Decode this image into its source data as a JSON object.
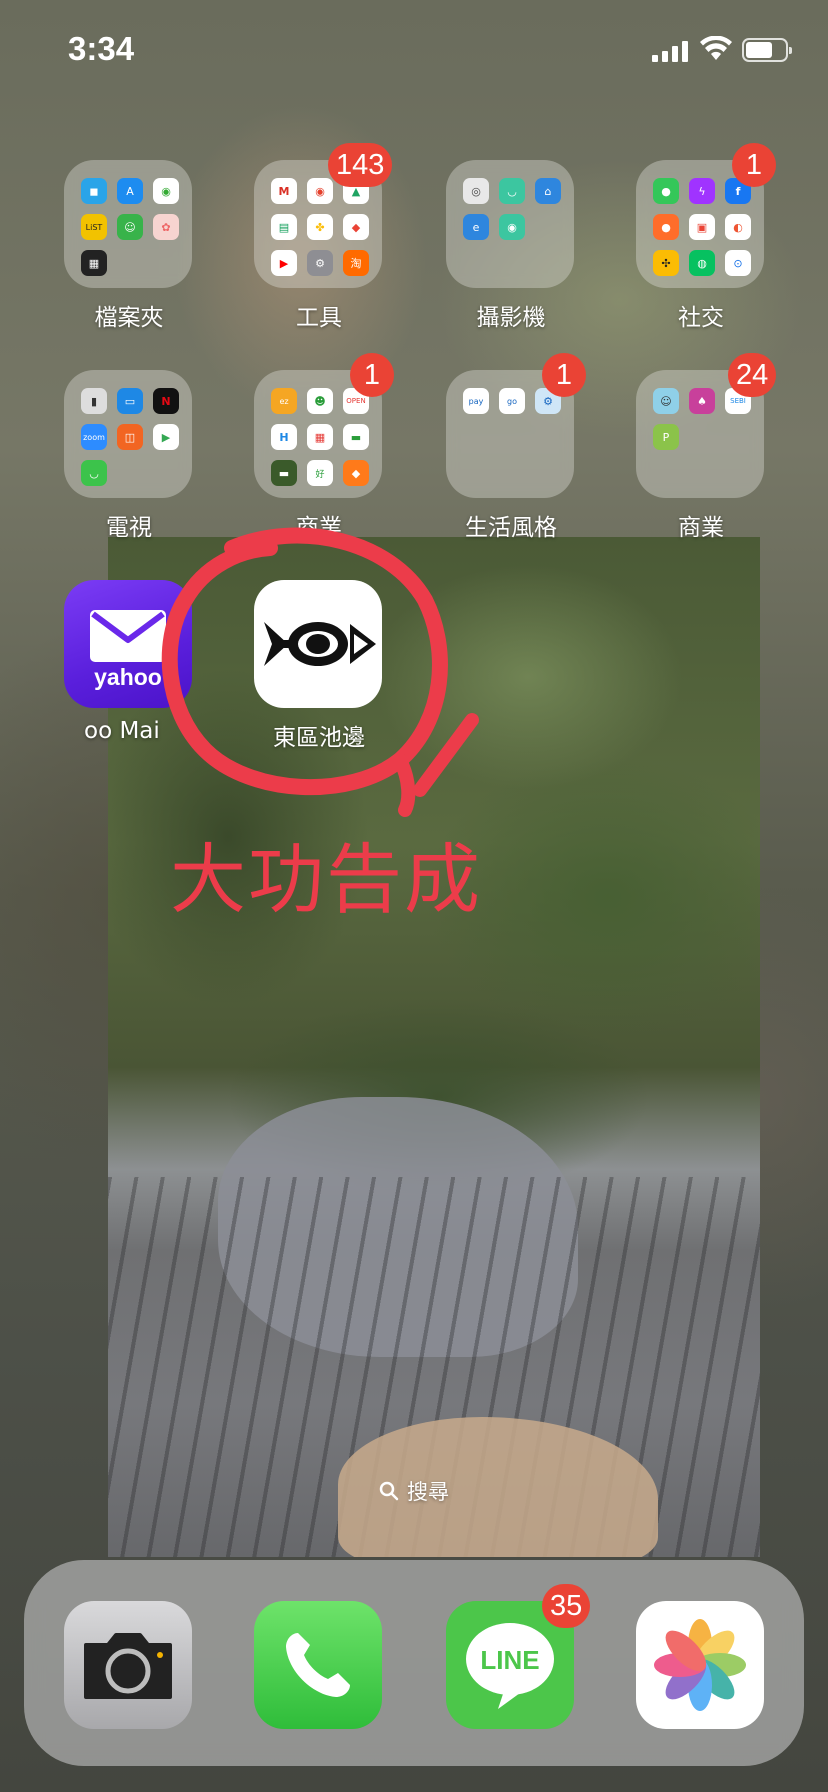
{
  "status_bar": {
    "time": "3:34"
  },
  "folders": [
    {
      "label": "檔案夾",
      "badge": ""
    },
    {
      "label": "工具",
      "badge": "143"
    },
    {
      "label": "攝影機",
      "badge": ""
    },
    {
      "label": "社交",
      "badge": "1"
    },
    {
      "label": "電視",
      "badge": ""
    },
    {
      "label": "商業",
      "badge": "1"
    },
    {
      "label": "生活風格",
      "badge": "1"
    },
    {
      "label": "商業",
      "badge": "24"
    }
  ],
  "apps": {
    "yahoo_mail": {
      "label": "oo Mai",
      "icon_text": "yahoo"
    },
    "fish_app": {
      "label": "東區池邊"
    }
  },
  "annotation": {
    "caption": "大功告成",
    "color": "#ec3c4a"
  },
  "search": {
    "label": "搜尋"
  },
  "dock": {
    "line_badge": "35",
    "line_text": "LINE"
  },
  "colors": {
    "badge": "#ea4335",
    "yahoo": "#6a28ea",
    "line": "#4cc64a"
  }
}
